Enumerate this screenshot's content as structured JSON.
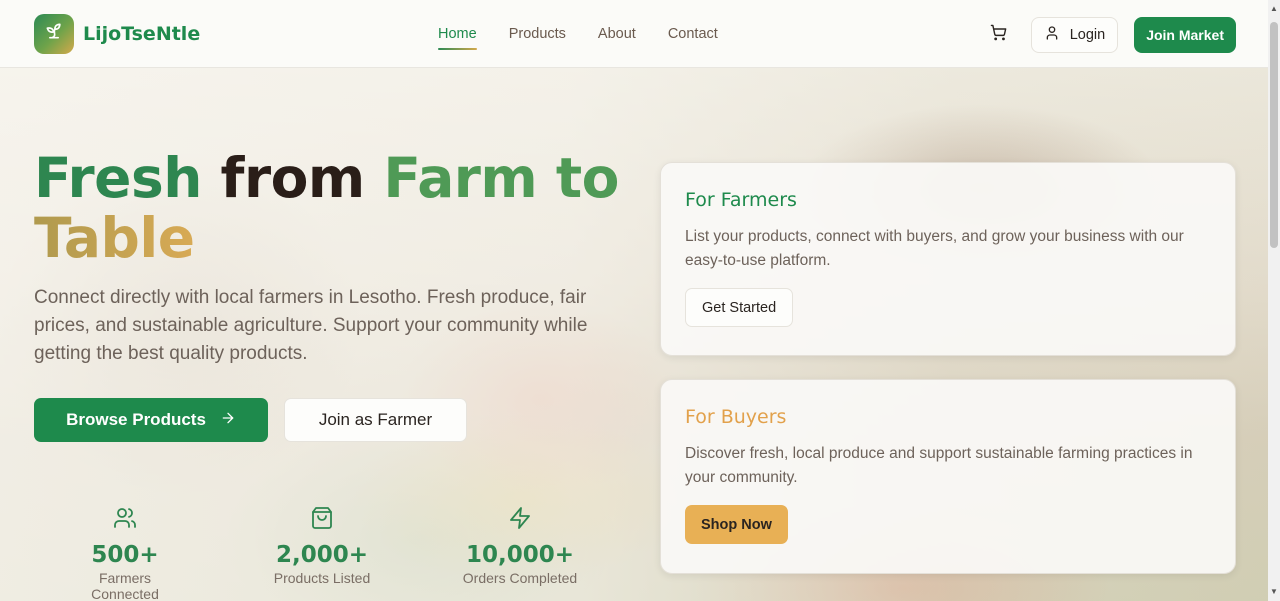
{
  "brand": {
    "name": "LijoTseNtle",
    "logo_icon": "sprout-icon"
  },
  "nav": {
    "links": [
      {
        "label": "Home",
        "active": true
      },
      {
        "label": "Products",
        "active": false
      },
      {
        "label": "About",
        "active": false
      },
      {
        "label": "Contact",
        "active": false
      }
    ],
    "cart_icon": "cart-icon",
    "login_label": "Login",
    "join_label": "Join Market"
  },
  "hero": {
    "headline": {
      "fresh": "Fresh",
      "from": "from",
      "farm_to": "Farm to",
      "table": "Table"
    },
    "subtitle": "Connect directly with local farmers in Lesotho. Fresh produce, fair prices, and sustainable agriculture. Support your community while getting the best quality products.",
    "browse_label": "Browse Products",
    "farmer_label": "Join as Farmer"
  },
  "stats": [
    {
      "icon": "users-icon",
      "value": "500+",
      "label": "Farmers Connected"
    },
    {
      "icon": "shopping-bag-icon",
      "value": "2,000+",
      "label": "Products Listed"
    },
    {
      "icon": "lightning-icon",
      "value": "10,000+",
      "label": "Orders Completed"
    }
  ],
  "cards": {
    "farmers": {
      "title": "For Farmers",
      "text": "List your products, connect with buyers, and grow your business with our easy-to-use platform.",
      "button": "Get Started"
    },
    "buyers": {
      "title": "For Buyers",
      "text": "Discover fresh, local produce and support sustainable farming practices in your community.",
      "button": "Shop Now"
    }
  },
  "colors": {
    "primary": "#1e8a4c",
    "accent": "#e8b055",
    "buyers_title": "#e2a14b"
  }
}
